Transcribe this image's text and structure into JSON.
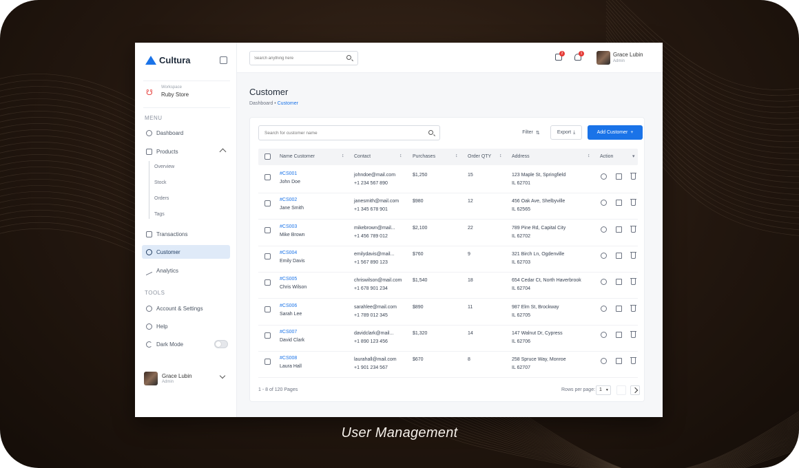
{
  "caption": "User Management",
  "app": {
    "name": "Cultura"
  },
  "workspace": {
    "sub": "Workspace",
    "name": "Ruby Store"
  },
  "sidebar": {
    "section1": "MENU",
    "items": [
      {
        "label": "Dashboard",
        "icon": "home-icon"
      },
      {
        "label": "Products",
        "icon": "box-icon"
      }
    ],
    "sub_items": [
      "Overview",
      "Stock",
      "Orders",
      "Tags"
    ],
    "items2": [
      {
        "label": "Transactions",
        "icon": "receipt-icon"
      },
      {
        "label": "Customer",
        "icon": "users-icon"
      },
      {
        "label": "Analytics",
        "icon": "chart-icon"
      }
    ],
    "section2": "TOOLS",
    "tools": [
      {
        "label": "Account & Settings",
        "icon": "gear-icon"
      },
      {
        "label": "Help",
        "icon": "help-icon"
      },
      {
        "label": "Dark Mode",
        "icon": "moon-icon"
      }
    ],
    "user": {
      "name": "Grace Lubin",
      "role": "Admin"
    }
  },
  "topbar": {
    "search_placeholder": "Search anything here",
    "notif_count": "2",
    "message_count": "1",
    "user": {
      "name": "Grace Lubin",
      "role": "Admin"
    }
  },
  "page": {
    "title": "Customer",
    "breadcrumb_root": "Dashboard",
    "breadcrumb_sep": "•",
    "breadcrumb_current": "Customer"
  },
  "table": {
    "search_placeholder": "Search for customer name",
    "filter_label": "Filter",
    "export_label": "Export",
    "add_label": "Add Customer",
    "columns": [
      "Name Customer",
      "Contact",
      "Purchases",
      "Order QTY",
      "Address",
      "Action"
    ],
    "rows": [
      {
        "id": "#CS001",
        "name": "John Doe",
        "email": "johndoe@mail.com",
        "phone": "+1 234 567 890",
        "purchases": "$1,250",
        "qty": "15",
        "address": "123 Maple St, Springfield",
        "address2": "IL 62701"
      },
      {
        "id": "#CS002",
        "name": "Jane Smith",
        "email": "janesmith@mail.com",
        "phone": "+1 345 678 901",
        "purchases": "$980",
        "qty": "12",
        "address": "456 Oak Ave, Shelbyville",
        "address2": "IL 62565"
      },
      {
        "id": "#CS003",
        "name": "Mike Brown",
        "email": "mikebrown@mail...",
        "phone": "+1 456 789 012",
        "purchases": "$2,100",
        "qty": "22",
        "address": "789 Pine Rd, Capital City",
        "address2": "IL 62702"
      },
      {
        "id": "#CS004",
        "name": "Emily Davis",
        "email": "emilydavis@mail...",
        "phone": "+1 567 890 123",
        "purchases": "$760",
        "qty": "9",
        "address": "321 Birch Ln, Ogdenville",
        "address2": "IL 62703"
      },
      {
        "id": "#CS005",
        "name": "Chris Wilson",
        "email": "chriswilson@mail.com",
        "phone": "+1 678 901 234",
        "purchases": "$1,540",
        "qty": "18",
        "address": "654 Cedar Ct, North Haverbrook",
        "address2": "IL 62704"
      },
      {
        "id": "#CS006",
        "name": "Sarah Lee",
        "email": "sarahlee@mail.com",
        "phone": "+1 789 012 345",
        "purchases": "$890",
        "qty": "11",
        "address": "987 Elm St, Brockway",
        "address2": "IL 62705"
      },
      {
        "id": "#CS007",
        "name": "David Clark",
        "email": "davidclark@mail...",
        "phone": "+1 890 123 456",
        "purchases": "$1,320",
        "qty": "14",
        "address": "147 Walnut Dr, Cypress",
        "address2": "IL 62706"
      },
      {
        "id": "#CS008",
        "name": "Laura Hall",
        "email": "laurahall@mail.com",
        "phone": "+1 901 234 567",
        "purchases": "$670",
        "qty": "8",
        "address": "258 Spruce Way, Monroe",
        "address2": "IL 62707"
      }
    ],
    "footer_info": "1 - 8 of 120 Pages",
    "rows_per_page_label": "Rows per page:",
    "page_number": "1"
  }
}
